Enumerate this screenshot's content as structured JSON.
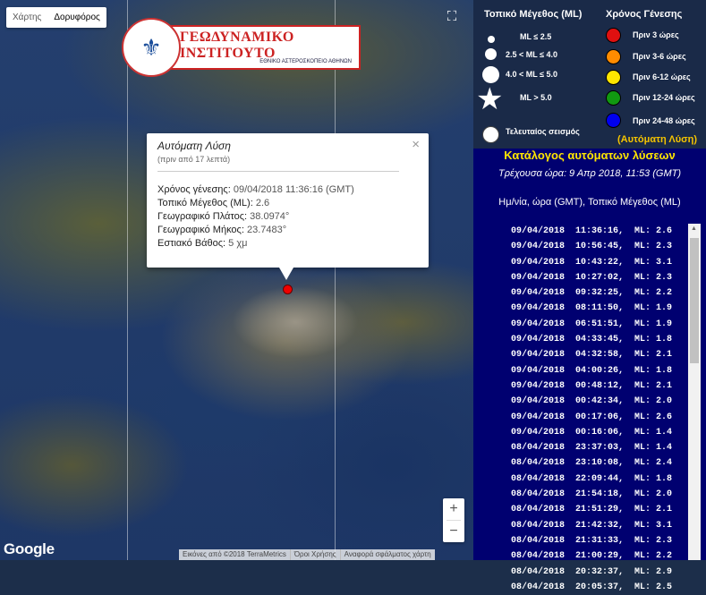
{
  "map": {
    "maptype_buttons": [
      "Χάρτης",
      "Δορυφόρος"
    ],
    "fullscreen_icon": "fullscreen-icon",
    "logo": {
      "title": "ΓΕΩΔΥΝΑΜΙΚΟ ΙΝΣΤΙΤΟΥΤΟ",
      "subtitle": "ΕΘΝΙΚΟ ΑΣΤΕΡΟΣΚΟΠΕΙΟ ΑΘΗΝΩΝ"
    },
    "popup": {
      "title": "Αυτόματη Λύση",
      "subtitle": "(πριν από 17 λεπτά)",
      "close": "×",
      "origin_label": "Χρόνος γένεσης:",
      "origin_value": "09/04/2018  11:36:16 (GMT)",
      "magnitude_label": "Τοπικό Μέγεθος (ML):",
      "magnitude_value": "2.6",
      "lat_label": "Γεωγραφικό Πλάτος:",
      "lat_value": "38.0974°",
      "lon_label": "Γεωγραφικό Μήκος:",
      "lon_value": "23.7483°",
      "depth_label": "Εστιακό Βάθος:",
      "depth_value": "5 χμ"
    },
    "zoom_in": "+",
    "zoom_out": "−",
    "google": "Google",
    "attribution": [
      "Εικόνες από ©2018 TerraMetrics",
      "Όροι Χρήσης",
      "Αναφορά σφάλματος χάρτη"
    ]
  },
  "legend": {
    "magnitude_header": "Τοπικό Μέγεθος (ML)",
    "origin_header": "Χρόνος Γένεσης",
    "magnitudes": [
      "ML ≤ 2.5",
      "2.5 < ML ≤ 4.0",
      "4.0 < ML ≤ 5.0",
      "ML > 5.0",
      "Τελευταίος σεισμός"
    ],
    "times": [
      {
        "label": "Πριν 3 ώρες",
        "color": "#e01010"
      },
      {
        "label": "Πριν 3-6 ώρες",
        "color": "#ff8c00"
      },
      {
        "label": "Πριν 6-12 ώρες",
        "color": "#ffe600"
      },
      {
        "label": "Πριν 12-24 ώρες",
        "color": "#119911"
      },
      {
        "label": "Πριν 24-48 ώρες",
        "color": "#0000ee"
      }
    ],
    "auto_note": "(Αυτόματη Λύση)"
  },
  "catalog": {
    "title": "Κατάλογος αυτόματων λύσεων",
    "current_time": "Τρέχουσα ώρα: 9 Απρ 2018, 11:53 (GMT)",
    "header": "Ημ/νία, ώρα (GMT), Τοπικό Μέγεθος (ML)",
    "rows": [
      "09/04/2018  11:36:16,  ML: 2.6",
      "09/04/2018  10:56:45,  ML: 2.3",
      "09/04/2018  10:43:22,  ML: 3.1",
      "09/04/2018  10:27:02,  ML: 2.3",
      "09/04/2018  09:32:25,  ML: 2.2",
      "09/04/2018  08:11:50,  ML: 1.9",
      "09/04/2018  06:51:51,  ML: 1.9",
      "09/04/2018  04:33:45,  ML: 1.8",
      "09/04/2018  04:32:58,  ML: 2.1",
      "09/04/2018  04:00:26,  ML: 1.8",
      "09/04/2018  00:48:12,  ML: 2.1",
      "09/04/2018  00:42:34,  ML: 2.0",
      "09/04/2018  00:17:06,  ML: 2.6",
      "09/04/2018  00:16:06,  ML: 1.4",
      "08/04/2018  23:37:03,  ML: 1.4",
      "08/04/2018  23:10:08,  ML: 2.4",
      "08/04/2018  22:09:44,  ML: 1.8",
      "08/04/2018  21:54:18,  ML: 2.0",
      "08/04/2018  21:51:29,  ML: 2.1",
      "08/04/2018  21:42:32,  ML: 3.1",
      "08/04/2018  21:31:33,  ML: 2.3",
      "08/04/2018  21:00:29,  ML: 2.2",
      "08/04/2018  20:32:37,  ML: 2.9",
      "08/04/2018  20:05:37,  ML: 2.5"
    ]
  }
}
